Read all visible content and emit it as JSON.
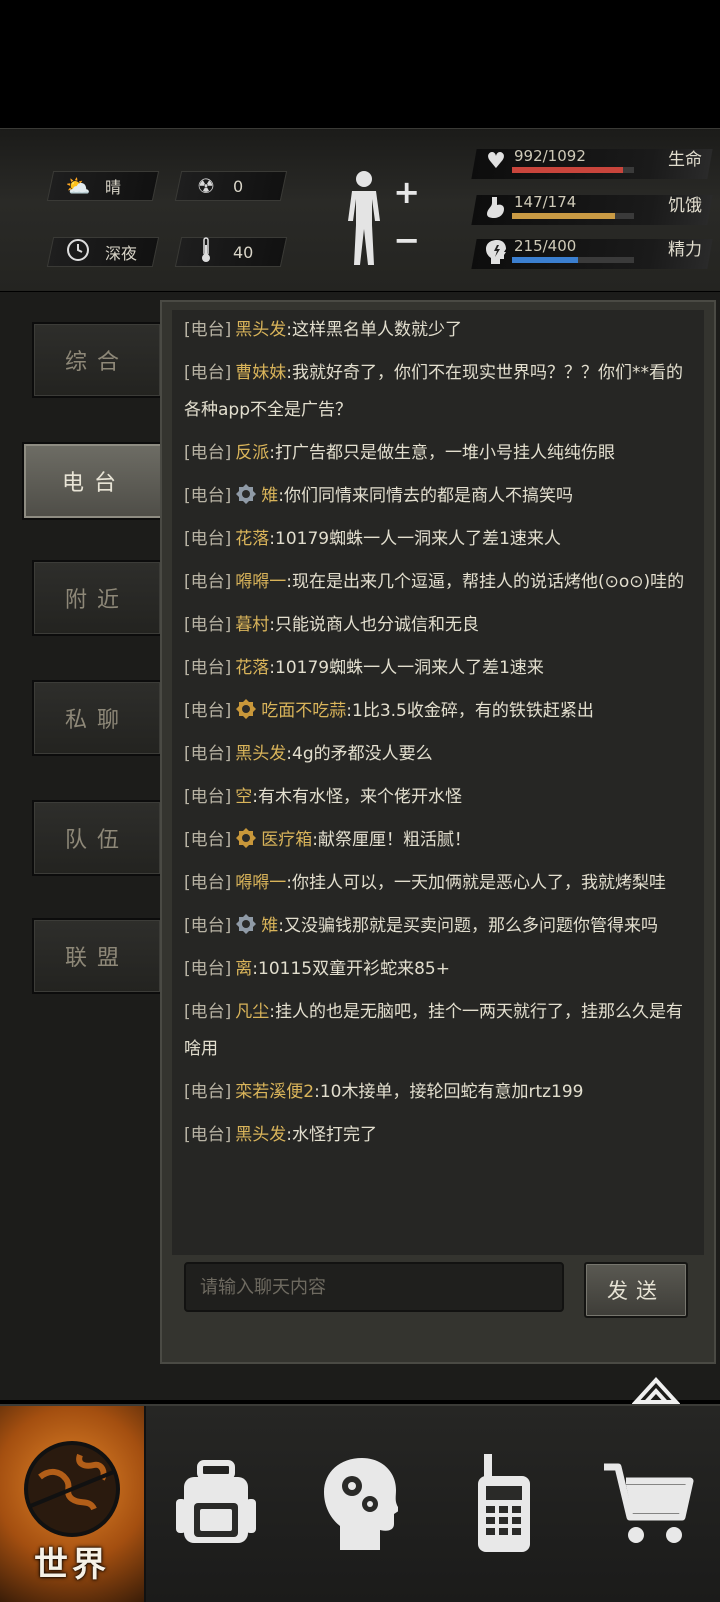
{
  "status": {
    "weather": "晴",
    "radiation": "0",
    "time_of_day": "深夜",
    "temperature": "40",
    "vitals": [
      {
        "icon": "heart-pulse-icon",
        "value": "992/1092",
        "label": "生命",
        "fraction": 0.908,
        "color": "#c9453c"
      },
      {
        "icon": "stomach-icon",
        "value": "147/174",
        "label": "饥饿",
        "fraction": 0.845,
        "color": "#c99a44"
      },
      {
        "icon": "head-energy-icon",
        "value": "215/400",
        "label": "精力",
        "fraction": 0.538,
        "color": "#3b7fd0"
      }
    ]
  },
  "tabs": [
    {
      "label": "综合",
      "active": false
    },
    {
      "label": "电台",
      "active": true
    },
    {
      "label": "附近",
      "active": false
    },
    {
      "label": "私聊",
      "active": false
    },
    {
      "label": "队伍",
      "active": false
    },
    {
      "label": "联盟",
      "active": false
    }
  ],
  "chat": {
    "channel_tag": "[电台]",
    "messages": [
      {
        "name": "黑头发",
        "badge": "",
        "text": "这样黑名单人数就少了"
      },
      {
        "name": "曹妹妹",
        "badge": "",
        "text": "我就好奇了，你们不在现实世界吗？？？你们**看的各种app不全是广告？"
      },
      {
        "name": "反派",
        "badge": "",
        "text": "打广告都只是做生意，一堆小号挂人纯纯伤眼"
      },
      {
        "name": "雉",
        "badge": "silver",
        "text": "你们同情来同情去的都是商人不搞笑吗"
      },
      {
        "name": "花落",
        "badge": "",
        "text": "10179蜘蛛一人一洞来人了差1速来人"
      },
      {
        "name": "嘚嘚一",
        "badge": "",
        "text": "现在是出来几个逗逼，帮挂人的说话烤他(⊙o⊙)哇的"
      },
      {
        "name": "暮村",
        "badge": "",
        "text": "只能说商人也分诚信和无良"
      },
      {
        "name": "花落",
        "badge": "",
        "text": "10179蜘蛛一人一洞来人了差1速来"
      },
      {
        "name": "吃面不吃蒜",
        "badge": "gold",
        "text": "1比3.5收金碎，有的铁铁赶紧出"
      },
      {
        "name": "黑头发",
        "badge": "",
        "text": "4g的矛都没人要么"
      },
      {
        "name": "空",
        "badge": "",
        "text": "有木有水怪，来个佬开水怪"
      },
      {
        "name": "医疗箱",
        "badge": "gold",
        "text": "献祭厘厘！粗活腻！"
      },
      {
        "name": "嘚嘚一",
        "badge": "",
        "text": "你挂人可以，一天加俩就是恶心人了，我就烤梨哇"
      },
      {
        "name": "雉",
        "badge": "silver",
        "text": "又没骗钱那就是买卖问题，那么多问题你管得来吗"
      },
      {
        "name": "离",
        "badge": "",
        "text": "10115双童开衫蛇来85+"
      },
      {
        "name": "凡尘",
        "badge": "",
        "text": "挂人的也是无脑吧，挂个一两天就行了，挂那么久是有啥用"
      },
      {
        "name": "栾若溪便2",
        "badge": "",
        "text": "10木接单，接轮回蛇有意加rtz199"
      },
      {
        "name": "黑头发",
        "badge": "",
        "text": "水怪打完了"
      }
    ],
    "input_placeholder": "请输入聊天内容",
    "send_label": "发送"
  },
  "bottom_nav": [
    {
      "icon": "globe-icon",
      "label": "世界",
      "active": true
    },
    {
      "icon": "backpack-icon",
      "label": "",
      "active": false
    },
    {
      "icon": "head-gears-icon",
      "label": "",
      "active": false
    },
    {
      "icon": "walkie-talkie-icon",
      "label": "",
      "active": false
    },
    {
      "icon": "shopping-cart-icon",
      "label": "",
      "active": false
    }
  ]
}
